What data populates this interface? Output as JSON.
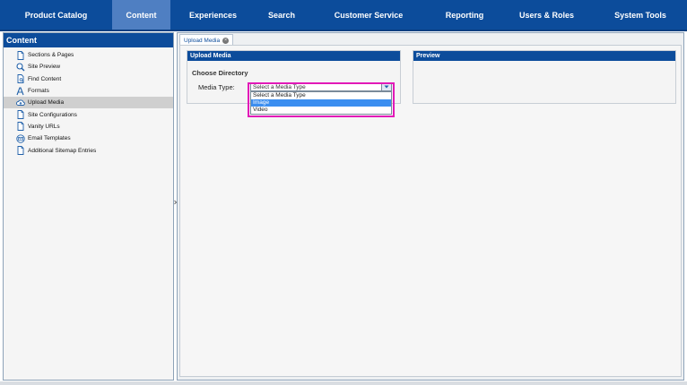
{
  "nav": {
    "items": [
      {
        "label": "Product Catalog",
        "active": false
      },
      {
        "label": "Content",
        "active": true
      },
      {
        "label": "Experiences",
        "active": false
      },
      {
        "label": "Search",
        "active": false
      },
      {
        "label": "Customer Service",
        "active": false
      },
      {
        "label": "Reporting",
        "active": false
      },
      {
        "label": "Users & Roles",
        "active": false
      },
      {
        "label": "System Tools",
        "active": false
      }
    ]
  },
  "sidebar": {
    "title": "Content",
    "items": [
      {
        "label": "Sections & Pages",
        "icon": "page-icon"
      },
      {
        "label": "Site Preview",
        "icon": "magnifier-icon"
      },
      {
        "label": "Find Content",
        "icon": "find-page-icon"
      },
      {
        "label": "Formats",
        "icon": "font-format-icon"
      },
      {
        "label": "Upload Media",
        "icon": "cloud-upload-icon",
        "selected": true
      },
      {
        "label": "Site Configurations",
        "icon": "page-icon"
      },
      {
        "label": "Vanity URLs",
        "icon": "page-icon"
      },
      {
        "label": "Email Templates",
        "icon": "envelope-icon"
      },
      {
        "label": "Additional Sitemap Entries",
        "icon": "page-icon"
      }
    ]
  },
  "tab": {
    "label": "Upload Media"
  },
  "upload": {
    "header": "Upload Media",
    "choose_directory": "Choose Directory",
    "media_type_label": "Media Type:",
    "select_value": "Select a Media Type",
    "options": [
      "Select a Media Type",
      "Image",
      "Video"
    ],
    "highlighted_option": "Image"
  },
  "preview": {
    "header": "Preview"
  },
  "colors": {
    "nav_bg": "#0c4c9b",
    "nav_active": "#4f7fc2",
    "highlight": "#e21ab8",
    "option_hover": "#3b8ef0"
  }
}
